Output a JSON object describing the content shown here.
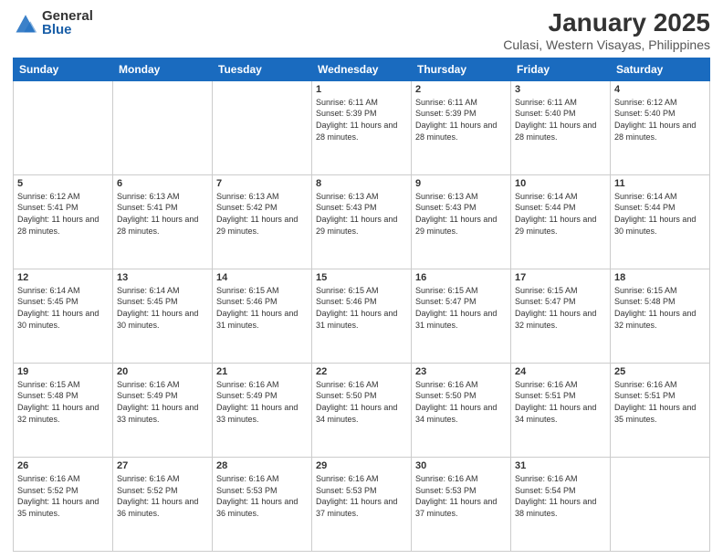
{
  "header": {
    "logo_general": "General",
    "logo_blue": "Blue",
    "title": "January 2025",
    "subtitle": "Culasi, Western Visayas, Philippines"
  },
  "weekdays": [
    "Sunday",
    "Monday",
    "Tuesday",
    "Wednesday",
    "Thursday",
    "Friday",
    "Saturday"
  ],
  "weeks": [
    [
      {
        "day": "",
        "sunrise": "",
        "sunset": "",
        "daylight": ""
      },
      {
        "day": "",
        "sunrise": "",
        "sunset": "",
        "daylight": ""
      },
      {
        "day": "",
        "sunrise": "",
        "sunset": "",
        "daylight": ""
      },
      {
        "day": "1",
        "sunrise": "Sunrise: 6:11 AM",
        "sunset": "Sunset: 5:39 PM",
        "daylight": "Daylight: 11 hours and 28 minutes."
      },
      {
        "day": "2",
        "sunrise": "Sunrise: 6:11 AM",
        "sunset": "Sunset: 5:39 PM",
        "daylight": "Daylight: 11 hours and 28 minutes."
      },
      {
        "day": "3",
        "sunrise": "Sunrise: 6:11 AM",
        "sunset": "Sunset: 5:40 PM",
        "daylight": "Daylight: 11 hours and 28 minutes."
      },
      {
        "day": "4",
        "sunrise": "Sunrise: 6:12 AM",
        "sunset": "Sunset: 5:40 PM",
        "daylight": "Daylight: 11 hours and 28 minutes."
      }
    ],
    [
      {
        "day": "5",
        "sunrise": "Sunrise: 6:12 AM",
        "sunset": "Sunset: 5:41 PM",
        "daylight": "Daylight: 11 hours and 28 minutes."
      },
      {
        "day": "6",
        "sunrise": "Sunrise: 6:13 AM",
        "sunset": "Sunset: 5:41 PM",
        "daylight": "Daylight: 11 hours and 28 minutes."
      },
      {
        "day": "7",
        "sunrise": "Sunrise: 6:13 AM",
        "sunset": "Sunset: 5:42 PM",
        "daylight": "Daylight: 11 hours and 29 minutes."
      },
      {
        "day": "8",
        "sunrise": "Sunrise: 6:13 AM",
        "sunset": "Sunset: 5:43 PM",
        "daylight": "Daylight: 11 hours and 29 minutes."
      },
      {
        "day": "9",
        "sunrise": "Sunrise: 6:13 AM",
        "sunset": "Sunset: 5:43 PM",
        "daylight": "Daylight: 11 hours and 29 minutes."
      },
      {
        "day": "10",
        "sunrise": "Sunrise: 6:14 AM",
        "sunset": "Sunset: 5:44 PM",
        "daylight": "Daylight: 11 hours and 29 minutes."
      },
      {
        "day": "11",
        "sunrise": "Sunrise: 6:14 AM",
        "sunset": "Sunset: 5:44 PM",
        "daylight": "Daylight: 11 hours and 30 minutes."
      }
    ],
    [
      {
        "day": "12",
        "sunrise": "Sunrise: 6:14 AM",
        "sunset": "Sunset: 5:45 PM",
        "daylight": "Daylight: 11 hours and 30 minutes."
      },
      {
        "day": "13",
        "sunrise": "Sunrise: 6:14 AM",
        "sunset": "Sunset: 5:45 PM",
        "daylight": "Daylight: 11 hours and 30 minutes."
      },
      {
        "day": "14",
        "sunrise": "Sunrise: 6:15 AM",
        "sunset": "Sunset: 5:46 PM",
        "daylight": "Daylight: 11 hours and 31 minutes."
      },
      {
        "day": "15",
        "sunrise": "Sunrise: 6:15 AM",
        "sunset": "Sunset: 5:46 PM",
        "daylight": "Daylight: 11 hours and 31 minutes."
      },
      {
        "day": "16",
        "sunrise": "Sunrise: 6:15 AM",
        "sunset": "Sunset: 5:47 PM",
        "daylight": "Daylight: 11 hours and 31 minutes."
      },
      {
        "day": "17",
        "sunrise": "Sunrise: 6:15 AM",
        "sunset": "Sunset: 5:47 PM",
        "daylight": "Daylight: 11 hours and 32 minutes."
      },
      {
        "day": "18",
        "sunrise": "Sunrise: 6:15 AM",
        "sunset": "Sunset: 5:48 PM",
        "daylight": "Daylight: 11 hours and 32 minutes."
      }
    ],
    [
      {
        "day": "19",
        "sunrise": "Sunrise: 6:15 AM",
        "sunset": "Sunset: 5:48 PM",
        "daylight": "Daylight: 11 hours and 32 minutes."
      },
      {
        "day": "20",
        "sunrise": "Sunrise: 6:16 AM",
        "sunset": "Sunset: 5:49 PM",
        "daylight": "Daylight: 11 hours and 33 minutes."
      },
      {
        "day": "21",
        "sunrise": "Sunrise: 6:16 AM",
        "sunset": "Sunset: 5:49 PM",
        "daylight": "Daylight: 11 hours and 33 minutes."
      },
      {
        "day": "22",
        "sunrise": "Sunrise: 6:16 AM",
        "sunset": "Sunset: 5:50 PM",
        "daylight": "Daylight: 11 hours and 34 minutes."
      },
      {
        "day": "23",
        "sunrise": "Sunrise: 6:16 AM",
        "sunset": "Sunset: 5:50 PM",
        "daylight": "Daylight: 11 hours and 34 minutes."
      },
      {
        "day": "24",
        "sunrise": "Sunrise: 6:16 AM",
        "sunset": "Sunset: 5:51 PM",
        "daylight": "Daylight: 11 hours and 34 minutes."
      },
      {
        "day": "25",
        "sunrise": "Sunrise: 6:16 AM",
        "sunset": "Sunset: 5:51 PM",
        "daylight": "Daylight: 11 hours and 35 minutes."
      }
    ],
    [
      {
        "day": "26",
        "sunrise": "Sunrise: 6:16 AM",
        "sunset": "Sunset: 5:52 PM",
        "daylight": "Daylight: 11 hours and 35 minutes."
      },
      {
        "day": "27",
        "sunrise": "Sunrise: 6:16 AM",
        "sunset": "Sunset: 5:52 PM",
        "daylight": "Daylight: 11 hours and 36 minutes."
      },
      {
        "day": "28",
        "sunrise": "Sunrise: 6:16 AM",
        "sunset": "Sunset: 5:53 PM",
        "daylight": "Daylight: 11 hours and 36 minutes."
      },
      {
        "day": "29",
        "sunrise": "Sunrise: 6:16 AM",
        "sunset": "Sunset: 5:53 PM",
        "daylight": "Daylight: 11 hours and 37 minutes."
      },
      {
        "day": "30",
        "sunrise": "Sunrise: 6:16 AM",
        "sunset": "Sunset: 5:53 PM",
        "daylight": "Daylight: 11 hours and 37 minutes."
      },
      {
        "day": "31",
        "sunrise": "Sunrise: 6:16 AM",
        "sunset": "Sunset: 5:54 PM",
        "daylight": "Daylight: 11 hours and 38 minutes."
      },
      {
        "day": "",
        "sunrise": "",
        "sunset": "",
        "daylight": ""
      }
    ]
  ]
}
